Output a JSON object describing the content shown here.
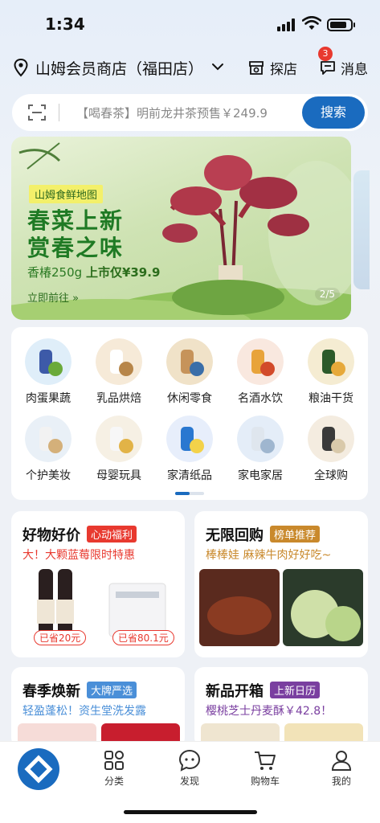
{
  "status_bar": {
    "time": "1:34"
  },
  "header": {
    "store_name": "山姆会员商店（福田店）",
    "explore_label": "探店",
    "message_label": "消息",
    "message_badge": "3"
  },
  "search": {
    "placeholder": "【喝春茶】明前龙井茶预售￥249.9",
    "button_label": "搜索"
  },
  "banner": {
    "tag": "山姆食鲜地图",
    "title_line1": "春菜上新",
    "title_line2": "赏春之味",
    "sub_product": "香椿250g",
    "sub_price": "上市仅¥39.9",
    "cta": "立即前往 »",
    "page_indicator": "2/5"
  },
  "categories": [
    {
      "label": "肉蛋果蔬",
      "icon": "produce-icon"
    },
    {
      "label": "乳品烘焙",
      "icon": "dairy-icon"
    },
    {
      "label": "休闲零食",
      "icon": "snacks-icon"
    },
    {
      "label": "名酒水饮",
      "icon": "drinks-icon"
    },
    {
      "label": "粮油干货",
      "icon": "oil-icon"
    },
    {
      "label": "个护美妆",
      "icon": "beauty-icon"
    },
    {
      "label": "母婴玩具",
      "icon": "baby-icon"
    },
    {
      "label": "家清纸品",
      "icon": "cleaning-icon"
    },
    {
      "label": "家电家居",
      "icon": "appliance-icon"
    },
    {
      "label": "全球购",
      "icon": "global-icon"
    }
  ],
  "promos": [
    {
      "title": "好物好价",
      "tag": "心动福利",
      "tag_color": "#e8392f",
      "subtitle": "大！大颗蓝莓限时特惠",
      "sub_color": "#e8392f",
      "save1": "已省20元",
      "save2": "已省80.1元"
    },
    {
      "title": "无限回购",
      "tag": "榜单推荐",
      "tag_color": "#c9892c",
      "subtitle": "棒棒娃 麻辣牛肉好好吃~",
      "sub_color": "#c9892c"
    },
    {
      "title": "春季焕新",
      "tag": "大牌严选",
      "tag_color": "#4a8fd8",
      "subtitle": "轻盈蓬松！资生堂洗发露",
      "sub_color": "#4a8fd8"
    },
    {
      "title": "新品开箱",
      "tag": "上新日历",
      "tag_color": "#7a3fa0",
      "subtitle": "樱桃芝士丹麦酥￥42.8！",
      "sub_color": "#7a3fa0"
    }
  ],
  "tabs": [
    {
      "label": "分类"
    },
    {
      "label": "发现"
    },
    {
      "label": "购物车"
    },
    {
      "label": "我的"
    }
  ],
  "colors": {
    "primary": "#1a6bbf",
    "badge": "#e8392f",
    "banner_green": "#1f7a24"
  }
}
